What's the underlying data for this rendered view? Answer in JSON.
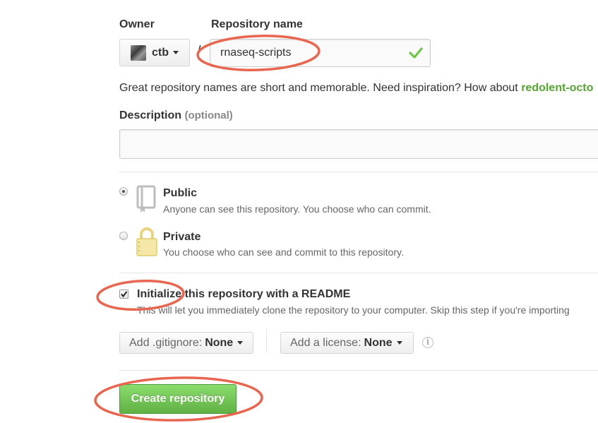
{
  "owner": {
    "label": "Owner",
    "name": "ctb"
  },
  "repository": {
    "label": "Repository name",
    "value": "rnaseq-scripts",
    "separator": "/"
  },
  "hint": {
    "text": "Great repository names are short and memorable. Need inspiration? How about ",
    "suggestion": "redolent-octo"
  },
  "description": {
    "label": "Description",
    "optional": "(optional)",
    "value": ""
  },
  "visibility": {
    "public": {
      "title": "Public",
      "desc": "Anyone can see this repository. You choose who can commit.",
      "selected": true
    },
    "private": {
      "title": "Private",
      "desc": "You choose who can see and commit to this repository.",
      "selected": false
    }
  },
  "readme": {
    "title": "Initialize this repository with a README",
    "desc": "This will let you immediately clone the repository to your computer. Skip this step if you're importing",
    "checked": true
  },
  "gitignore": {
    "prefix": "Add .gitignore:",
    "value": "None"
  },
  "license": {
    "prefix": "Add a license:",
    "value": "None"
  },
  "create_button": "Create repository",
  "colors": {
    "accent_green": "#55a532",
    "annotation_red": "#e8654f",
    "button_green": "#60b044"
  },
  "icons": [
    "chevron-down-icon",
    "checkmark-icon",
    "book-icon",
    "lock-icon",
    "info-icon"
  ]
}
